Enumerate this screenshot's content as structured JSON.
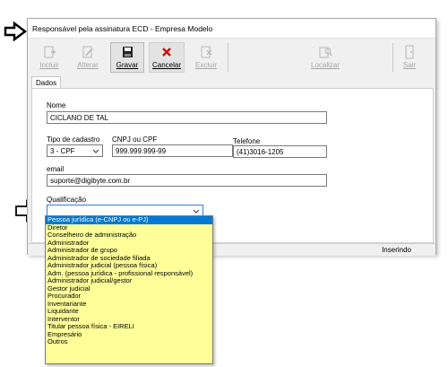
{
  "window": {
    "title": "Responsável pela assinatura ECD - Empresa Modelo"
  },
  "toolbar": {
    "incluir": "Incluir",
    "alterar": "Alterar",
    "gravar": "Gravar",
    "cancelar": "Cancelar",
    "excluir": "Excluir",
    "localizar": "Localizar",
    "sair": "Sair"
  },
  "tabs": {
    "dados": "Dados"
  },
  "form": {
    "nome_label": "Nome",
    "nome_value": "CICLANO DE TAL",
    "tipo_label": "Tipo de cadastro",
    "tipo_value": "3 - CPF",
    "cnpj_label": "CNPJ ou CPF",
    "cnpj_value": "999.999.999-99",
    "telefone_label": "Telefone",
    "telefone_value": "(41)3016-1205",
    "email_label": "email",
    "email_value": "suporte@digibyte.com.br",
    "qualificacao_label": "Qualificação",
    "qualificacao_value": ""
  },
  "status": {
    "mode": "Inserindo"
  },
  "qualificacao_options": [
    "Pessoa jurídica (e-CNPJ ou e-PJ)",
    "Diretor",
    "Conselheiro de administração",
    "Administrador",
    "Administrador de grupo",
    "Administrador de sociedade filiada",
    "Administrador judicial (pessoa física)",
    "Adm. (pessoa jurídica - profissional responsável)",
    "Administrador judicial/gestor",
    "Gestor judicial",
    "Procurador",
    "Inventariante",
    "Liquidante",
    "Interventor",
    "Titular pessoa física - EIRELI",
    "Empresário",
    "Outros"
  ],
  "colors": {
    "dropdown_bg": "#ffff99",
    "selected_bg": "#0078d7",
    "cancel_icon": "#cc1111"
  },
  "icons": {
    "callout_top": "right-arrow-icon",
    "callout_left": "right-arrow-outline-icon"
  }
}
